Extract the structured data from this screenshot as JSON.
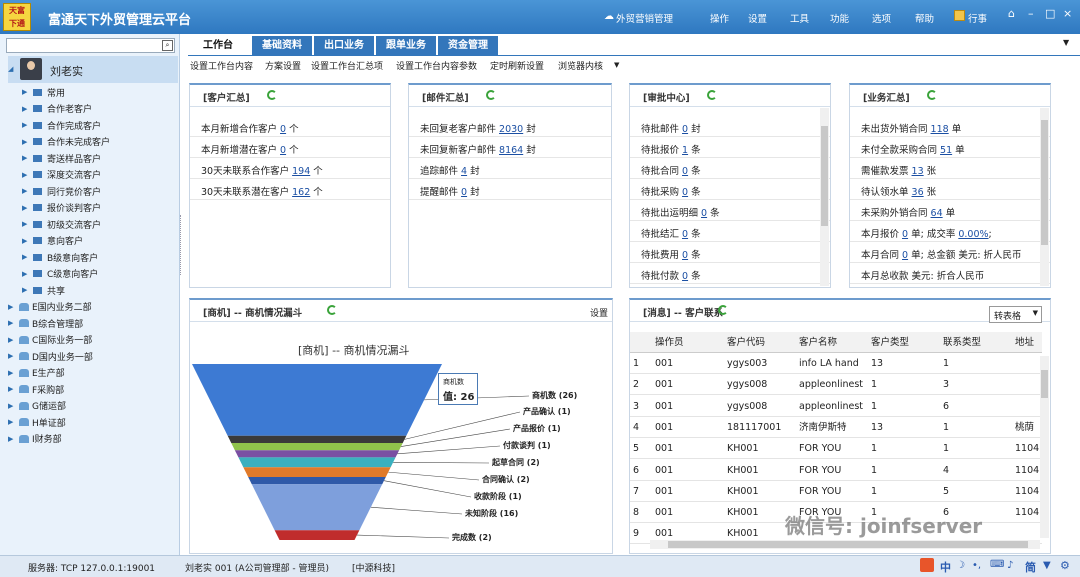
{
  "app": {
    "logo_text_top": "天富",
    "logo_text_bottom": "下通",
    "title": "富通天下外贸管理云平台"
  },
  "topmenu": {
    "cloud": "外贸营销管理",
    "items": [
      "操作",
      "设置",
      "工具",
      "功能",
      "选项",
      "帮助"
    ],
    "schedule": "行事"
  },
  "left": {
    "user": "刘老实",
    "groups": [
      "常用",
      "合作老客户",
      "合作完成客户",
      "合作未完成客户",
      "寄送样品客户",
      "深度交流客户",
      "同行竞价客户",
      "报价谈判客户",
      "初级交流客户",
      "意向客户",
      "B级意向客户",
      "C级意向客户",
      "共享"
    ],
    "departments": [
      "E国内业务二部",
      "B综合管理部",
      "C国际业务一部",
      "D国内业务一部",
      "E生产部",
      "F采购部",
      "G储运部",
      "H单证部",
      "I财务部"
    ]
  },
  "tabs": [
    "工作台",
    "基础资料",
    "出口业务",
    "跟单业务",
    "资金管理"
  ],
  "subtoolbar": [
    "设置工作台内容",
    "方案设置",
    "设置工作台汇总项",
    "设置工作台内容参数",
    "定时刷新设置",
    "浏览器内核"
  ],
  "panels": {
    "customer": {
      "title": "[客户汇总]",
      "rows": [
        {
          "pre": "本月新增合作客户 ",
          "val": "0",
          "post": " 个"
        },
        {
          "pre": "本月新增潜在客户 ",
          "val": "0",
          "post": " 个"
        },
        {
          "pre": "30天未联系合作客户 ",
          "val": "194",
          "post": " 个"
        },
        {
          "pre": "30天未联系潜在客户 ",
          "val": "162",
          "post": " 个"
        }
      ]
    },
    "mail": {
      "title": "[邮件汇总]",
      "rows": [
        {
          "pre": "未回复老客户邮件 ",
          "val": "2030",
          "post": " 封"
        },
        {
          "pre": "未回复新客户邮件 ",
          "val": "8164",
          "post": " 封"
        },
        {
          "pre": "追踪邮件 ",
          "val": "4",
          "post": " 封"
        },
        {
          "pre": "提醒邮件 ",
          "val": "0",
          "post": " 封"
        }
      ]
    },
    "approval": {
      "title": "[审批中心]",
      "rows": [
        {
          "pre": "待批邮件 ",
          "val": "0",
          "post": " 封"
        },
        {
          "pre": "待批报价 ",
          "val": "1",
          "post": " 条"
        },
        {
          "pre": "待批合同 ",
          "val": "0",
          "post": " 条"
        },
        {
          "pre": "待批采购 ",
          "val": "0",
          "post": " 条"
        },
        {
          "pre": "待批出运明细 ",
          "val": "0",
          "post": " 条"
        },
        {
          "pre": "待批结汇 ",
          "val": "0",
          "post": " 条"
        },
        {
          "pre": "待批费用 ",
          "val": "0",
          "post": " 条"
        },
        {
          "pre": "待批付款 ",
          "val": "0",
          "post": " 条"
        }
      ]
    },
    "business": {
      "title": "[业务汇总]",
      "rows": [
        {
          "pre": "未出货外销合同 ",
          "val": "118",
          "post": " 单"
        },
        {
          "pre": "未付全款采购合同 ",
          "val": "51",
          "post": " 单"
        },
        {
          "pre": "需催款发票 ",
          "val": "13",
          "post": " 张"
        },
        {
          "pre": "待认领水单 ",
          "val": "36",
          "post": " 张"
        },
        {
          "pre": "未采购外销合同 ",
          "val": "64",
          "post": " 单"
        },
        {
          "pre": "本月报价 ",
          "val": "0",
          "post": " 单; 成交率 ",
          "val2": "0.00%",
          "post2": ";"
        },
        {
          "pre": "本月合同 ",
          "val": "0",
          "post": " 单; 总金额 美元: 折人民币"
        },
        {
          "pre": "本月总收款 美元: 折合人民币",
          "val": "",
          "post": ""
        }
      ]
    }
  },
  "funnel": {
    "panel_title": "[商机] -- 商机情况漏斗",
    "settings": "设置",
    "chart_title": "[商机] -- 商机情况漏斗",
    "tooltip_title": "商机数",
    "tooltip_value": "值: 26"
  },
  "chart_data": {
    "type": "funnel",
    "title": "[商机] -- 商机情况漏斗",
    "stages": [
      {
        "name": "商机数",
        "value": 26,
        "color": "#3d7ad3",
        "label": "商机数 (26)"
      },
      {
        "name": "产品确认",
        "value": 1,
        "color": "#3a3a3a",
        "label": "产品确认 (1)"
      },
      {
        "name": "产品报价",
        "value": 1,
        "color": "#90c34b",
        "label": "产品报价 (1)"
      },
      {
        "name": "付款谈判",
        "value": 1,
        "color": "#7a4fa3",
        "label": "付款谈判 (1)"
      },
      {
        "name": "起草合同",
        "value": 2,
        "color": "#3ab0bf",
        "label": "起草合同 (2)"
      },
      {
        "name": "合同确认",
        "value": 2,
        "color": "#e07a2a",
        "label": "合同确认 (2)"
      },
      {
        "name": "收款阶段",
        "value": 1,
        "color": "#2f59a8",
        "label": "收款阶段 (1)"
      },
      {
        "name": "未知阶段",
        "value": 16,
        "color": "#7e9fdc",
        "label": "未知阶段 (16)"
      },
      {
        "name": "完成数",
        "value": 2,
        "color": "#c02c2c",
        "label": "完成数 (2)"
      }
    ]
  },
  "messages": {
    "panel_title": "[消息] -- 客户联系",
    "select_value": "转表格",
    "headers": [
      "操作员",
      "客户代码",
      "客户名称",
      "客户类型",
      "联系类型",
      "地址"
    ],
    "rows": [
      [
        "1",
        "001",
        "ygys003",
        "info LA hand",
        "13",
        "1",
        ""
      ],
      [
        "2",
        "001",
        "ygys008",
        "appleonlinest",
        "1",
        "3",
        ""
      ],
      [
        "3",
        "001",
        "ygys008",
        "appleonlinest",
        "1",
        "6",
        ""
      ],
      [
        "4",
        "001",
        "181117001",
        "济南伊斯特",
        "13",
        "1",
        "桃荫"
      ],
      [
        "5",
        "001",
        "KH001",
        "FOR YOU",
        "1",
        "1",
        "1104"
      ],
      [
        "6",
        "001",
        "KH001",
        "FOR YOU",
        "1",
        "4",
        "1104"
      ],
      [
        "7",
        "001",
        "KH001",
        "FOR YOU",
        "1",
        "5",
        "1104"
      ],
      [
        "8",
        "001",
        "KH001",
        "FOR YOU",
        "1",
        "6",
        "1104"
      ],
      [
        "9",
        "001",
        "KH001",
        "",
        "",
        "",
        ""
      ]
    ]
  },
  "status": {
    "server": "服务器: TCP  127.0.0.1:19001",
    "user": "刘老实 001 (A公司管理部 - 管理员)",
    "company": "[中源科技]",
    "lang": "中",
    "simplified": "简"
  },
  "watermark": "微信号: joinfserver"
}
